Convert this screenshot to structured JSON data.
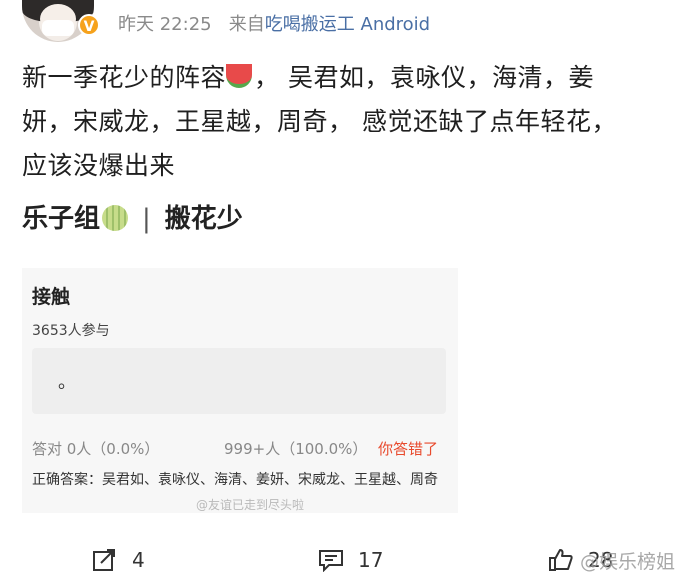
{
  "header": {
    "time": "昨天 22:25",
    "source_prefix": "来自",
    "source": "吃喝搬运工 Android"
  },
  "post": {
    "line1_before_emoji": "新一季花少的阵容",
    "line1_after_emoji": "， 吴君如，袁咏仪，海清，姜",
    "line2": "妍，宋威龙，王星越，周奇， 感觉还缺了点年轻花，",
    "line3": "应该没爆出来"
  },
  "section": {
    "group": "乐子组",
    "separator": "|",
    "topic": "搬花少"
  },
  "quiz": {
    "title": "接触",
    "participants": "3653人参与",
    "answer_placeholder": "。",
    "stat_correct": "答对 0人（0.0%）",
    "stat_wrong_count": "999+人（100.0%）",
    "wrong_label": "你答错了",
    "correct_answer": "正确答案：吴君如、袁咏仪、海清、姜妍、宋威龙、王星越、周奇"
  },
  "watermark_small": "@友谊已走到尽头啦",
  "actions": {
    "share_count": "4",
    "comment_count": "17",
    "like_count": "28"
  },
  "watermark": "@娱乐榜姐"
}
